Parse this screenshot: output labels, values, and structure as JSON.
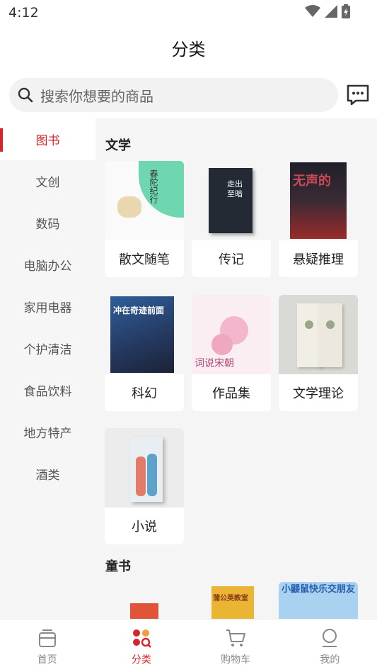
{
  "status": {
    "time": "4:12"
  },
  "header": {
    "title": "分类"
  },
  "search": {
    "placeholder": "搜索你想要的商品"
  },
  "sidebar": {
    "items": [
      {
        "label": "图书",
        "active": true
      },
      {
        "label": "文创"
      },
      {
        "label": "数码"
      },
      {
        "label": "电脑办公"
      },
      {
        "label": "家用电器"
      },
      {
        "label": "个护清洁"
      },
      {
        "label": "食品饮料"
      },
      {
        "label": "地方特产"
      },
      {
        "label": "酒类"
      }
    ]
  },
  "sections": [
    {
      "title": "文学",
      "items": [
        {
          "label": "散文随笔",
          "cover_text": "春陀纪行"
        },
        {
          "label": "传记",
          "cover_text": "走出至暗"
        },
        {
          "label": "悬疑推理",
          "cover_text": "无声的"
        },
        {
          "label": "科幻",
          "cover_text": "冲在奇迹前面"
        },
        {
          "label": "作品集",
          "cover_text": "词说宋朝"
        },
        {
          "label": "文学理论",
          "cover_text": ""
        },
        {
          "label": "小说",
          "cover_text": ""
        }
      ]
    },
    {
      "title": "童书",
      "items": [
        {
          "label": "",
          "cover_text": ""
        },
        {
          "label": "",
          "cover_text": "蒲公英教室"
        },
        {
          "label": "",
          "cover_text": "小鼹鼠快乐交朋友"
        }
      ]
    }
  ],
  "tabbar": {
    "tabs": [
      {
        "label": "首页"
      },
      {
        "label": "分类",
        "active": true
      },
      {
        "label": "购物车"
      },
      {
        "label": "我的"
      }
    ]
  },
  "colors": {
    "accent": "#d8232a"
  }
}
